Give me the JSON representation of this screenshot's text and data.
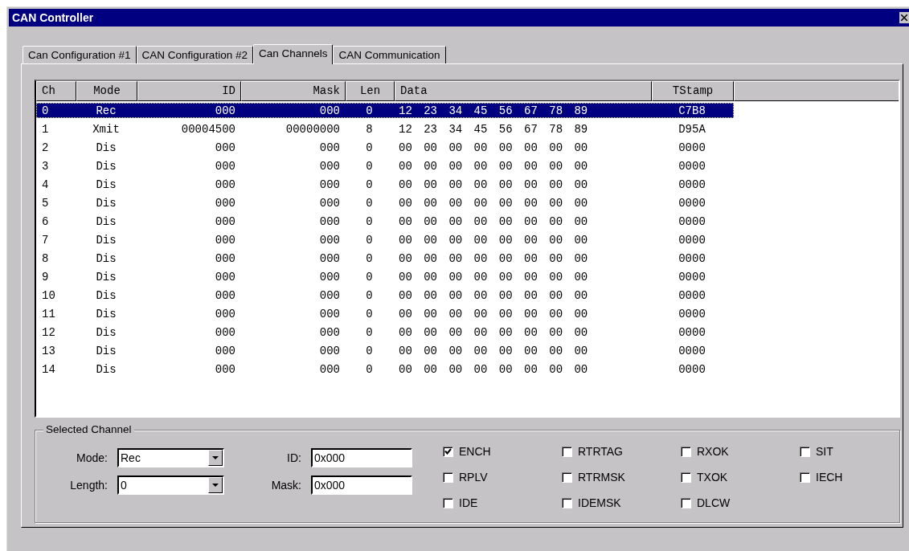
{
  "window": {
    "title": "CAN Controller"
  },
  "tabs": [
    {
      "label": "Can Configuration #1",
      "selected": false
    },
    {
      "label": "CAN Configuration #2",
      "selected": false
    },
    {
      "label": "Can Channels",
      "selected": true
    },
    {
      "label": "CAN Communication",
      "selected": false
    }
  ],
  "table": {
    "columns": [
      "Ch",
      "Mode",
      "ID",
      "Mask",
      "Len",
      "Data",
      "TStamp"
    ],
    "rows": [
      {
        "ch": "0",
        "mode": "Rec",
        "id": "000",
        "mask": "000",
        "len": "0",
        "data": "12 23 34 45 56 67 78 89",
        "tstamp": "C7B8",
        "selected": true
      },
      {
        "ch": "1",
        "mode": "Xmit",
        "id": "00004500",
        "mask": "00000000",
        "len": "8",
        "data": "12 23 34 45 56 67 78 89",
        "tstamp": "D95A",
        "selected": false
      },
      {
        "ch": "2",
        "mode": "Dis",
        "id": "000",
        "mask": "000",
        "len": "0",
        "data": "00 00 00 00 00 00 00 00",
        "tstamp": "0000",
        "selected": false
      },
      {
        "ch": "3",
        "mode": "Dis",
        "id": "000",
        "mask": "000",
        "len": "0",
        "data": "00 00 00 00 00 00 00 00",
        "tstamp": "0000",
        "selected": false
      },
      {
        "ch": "4",
        "mode": "Dis",
        "id": "000",
        "mask": "000",
        "len": "0",
        "data": "00 00 00 00 00 00 00 00",
        "tstamp": "0000",
        "selected": false
      },
      {
        "ch": "5",
        "mode": "Dis",
        "id": "000",
        "mask": "000",
        "len": "0",
        "data": "00 00 00 00 00 00 00 00",
        "tstamp": "0000",
        "selected": false
      },
      {
        "ch": "6",
        "mode": "Dis",
        "id": "000",
        "mask": "000",
        "len": "0",
        "data": "00 00 00 00 00 00 00 00",
        "tstamp": "0000",
        "selected": false
      },
      {
        "ch": "7",
        "mode": "Dis",
        "id": "000",
        "mask": "000",
        "len": "0",
        "data": "00 00 00 00 00 00 00 00",
        "tstamp": "0000",
        "selected": false
      },
      {
        "ch": "8",
        "mode": "Dis",
        "id": "000",
        "mask": "000",
        "len": "0",
        "data": "00 00 00 00 00 00 00 00",
        "tstamp": "0000",
        "selected": false
      },
      {
        "ch": "9",
        "mode": "Dis",
        "id": "000",
        "mask": "000",
        "len": "0",
        "data": "00 00 00 00 00 00 00 00",
        "tstamp": "0000",
        "selected": false
      },
      {
        "ch": "10",
        "mode": "Dis",
        "id": "000",
        "mask": "000",
        "len": "0",
        "data": "00 00 00 00 00 00 00 00",
        "tstamp": "0000",
        "selected": false
      },
      {
        "ch": "11",
        "mode": "Dis",
        "id": "000",
        "mask": "000",
        "len": "0",
        "data": "00 00 00 00 00 00 00 00",
        "tstamp": "0000",
        "selected": false
      },
      {
        "ch": "12",
        "mode": "Dis",
        "id": "000",
        "mask": "000",
        "len": "0",
        "data": "00 00 00 00 00 00 00 00",
        "tstamp": "0000",
        "selected": false
      },
      {
        "ch": "13",
        "mode": "Dis",
        "id": "000",
        "mask": "000",
        "len": "0",
        "data": "00 00 00 00 00 00 00 00",
        "tstamp": "0000",
        "selected": false
      },
      {
        "ch": "14",
        "mode": "Dis",
        "id": "000",
        "mask": "000",
        "len": "0",
        "data": "00 00 00 00 00 00 00 00",
        "tstamp": "0000",
        "selected": false
      }
    ]
  },
  "selected_channel": {
    "title": "Selected Channel",
    "mode": {
      "label": "Mode:",
      "value": "Rec"
    },
    "length": {
      "label": "Length:",
      "value": "0"
    },
    "id": {
      "label": "ID:",
      "value": "0x000"
    },
    "mask": {
      "label": "Mask:",
      "value": "0x000"
    },
    "flag_columns": [
      [
        {
          "label": "ENCH",
          "checked": true
        },
        {
          "label": "RPLV",
          "checked": false
        },
        {
          "label": "IDE",
          "checked": false
        }
      ],
      [
        {
          "label": "RTRTAG",
          "checked": false
        },
        {
          "label": "RTRMSK",
          "checked": false
        },
        {
          "label": "IDEMSK",
          "checked": false
        }
      ],
      [
        {
          "label": "RXOK",
          "checked": false
        },
        {
          "label": "TXOK",
          "checked": false
        },
        {
          "label": "DLCW",
          "checked": false
        }
      ],
      [
        {
          "label": "SIT",
          "checked": false
        },
        {
          "label": "IECH",
          "checked": false
        }
      ]
    ]
  }
}
